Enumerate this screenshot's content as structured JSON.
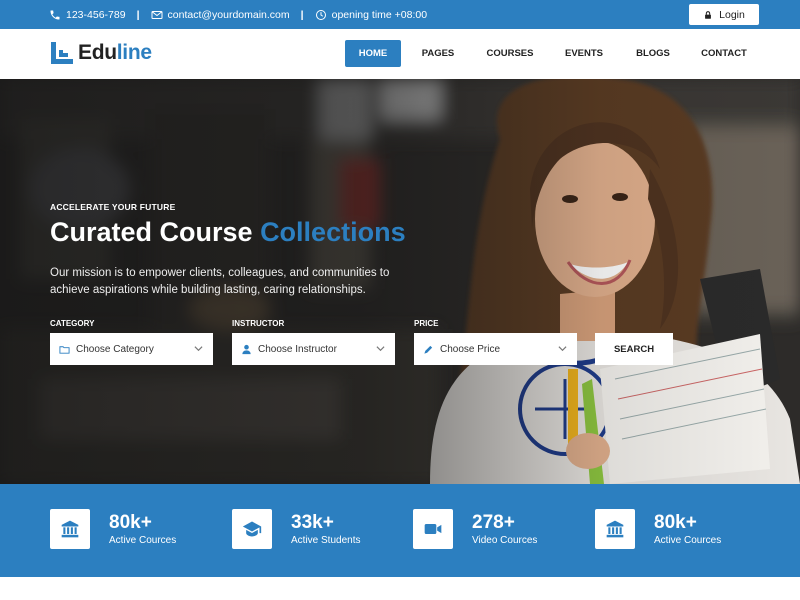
{
  "topbar": {
    "phone": "123-456-789",
    "email": "contact@yourdomain.com",
    "hours": "opening time +08:00",
    "separator": "|",
    "login_label": "Login"
  },
  "brand": {
    "name_prefix": "Edu",
    "name_suffix": "line",
    "accent_color": "#2c7fc0"
  },
  "nav": {
    "items": [
      {
        "label": "HOME",
        "active": true
      },
      {
        "label": "PAGES"
      },
      {
        "label": "COURSES"
      },
      {
        "label": "EVENTS"
      },
      {
        "label": "BLOGS"
      },
      {
        "label": "CONTACT"
      }
    ]
  },
  "hero": {
    "eyebrow": "ACCELERATE YOUR FUTURE",
    "headline_main": "Curated Course",
    "headline_accent": "Collections",
    "mission": "Our mission is to empower clients, colleagues, and communities to achieve aspirations while building lasting, caring relationships."
  },
  "filters": {
    "category": {
      "label": "CATEGORY",
      "value": "Choose Category",
      "icon": "folder-icon"
    },
    "instructor": {
      "label": "INSTRUCTOR",
      "value": "Choose Instructor",
      "icon": "user-icon"
    },
    "price": {
      "label": "PRICE",
      "value": "Choose Price",
      "icon": "pencil-icon"
    },
    "search_label": "SEARCH"
  },
  "stats": [
    {
      "value": "80k+",
      "label": "Active Cources",
      "icon": "institution-icon"
    },
    {
      "value": "33k+",
      "label": "Active Students",
      "icon": "graduation-cap-icon"
    },
    {
      "value": "278+",
      "label": "Video Cources",
      "icon": "video-camera-icon"
    },
    {
      "value": "80k+",
      "label": "Active Cources",
      "icon": "institution-icon"
    }
  ]
}
